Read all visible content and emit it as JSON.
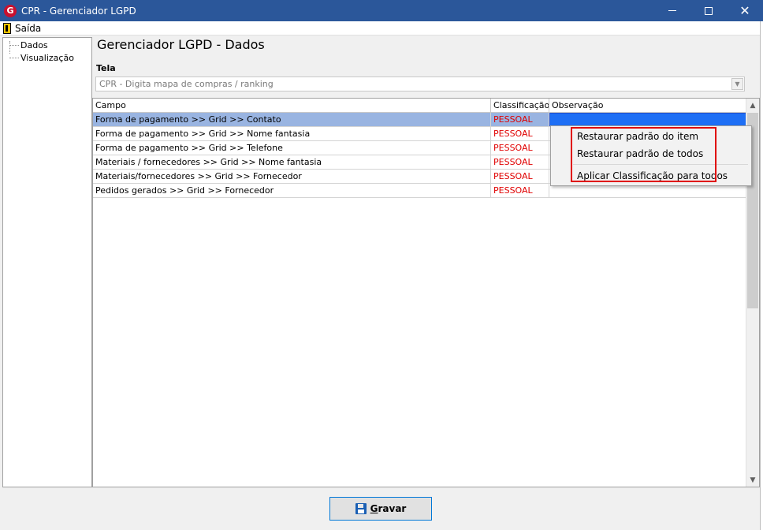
{
  "window": {
    "title": "CPR - Gerenciador LGPD",
    "app_icon_letter": "G",
    "minimize": "",
    "maximize": "",
    "close": "✕"
  },
  "menubar": {
    "exit_label": "Saída"
  },
  "tree": {
    "items": [
      {
        "label": "Dados"
      },
      {
        "label": "Visualização"
      }
    ]
  },
  "main": {
    "title": "Gerenciador LGPD - Dados",
    "tela_label": "Tela",
    "tela_value": "CPR - Digita mapa de compras / ranking"
  },
  "grid": {
    "columns": [
      "Campo",
      "Classificação",
      "Observação"
    ],
    "rows": [
      {
        "campo": "Forma de pagamento >> Grid >> Contato",
        "classificacao": "PESSOAL",
        "observacao": ""
      },
      {
        "campo": "Forma de pagamento >> Grid >> Nome fantasia",
        "classificacao": "PESSOAL",
        "observacao": ""
      },
      {
        "campo": "Forma de pagamento >> Grid >> Telefone",
        "classificacao": "PESSOAL",
        "observacao": ""
      },
      {
        "campo": "Materiais / fornecedores >> Grid >> Nome fantasia",
        "classificacao": "PESSOAL",
        "observacao": ""
      },
      {
        "campo": "Materiais/fornecedores >> Grid >> Fornecedor",
        "classificacao": "PESSOAL",
        "observacao": ""
      },
      {
        "campo": "Pedidos gerados >> Grid >> Fornecedor",
        "classificacao": "PESSOAL",
        "observacao": ""
      }
    ],
    "selected_row": 0
  },
  "context_menu": {
    "items": [
      "Restaurar padrão do item",
      "Restaurar padrão de todos",
      "Aplicar Classificação para todos"
    ]
  },
  "footer": {
    "save_label": "Gravar"
  },
  "colors": {
    "titlebar": "#2b579a",
    "selected_row": "#99b4e1",
    "selected_cell": "#1e6ff5",
    "classification_text": "#e00000",
    "highlight_box": "#e00000"
  }
}
